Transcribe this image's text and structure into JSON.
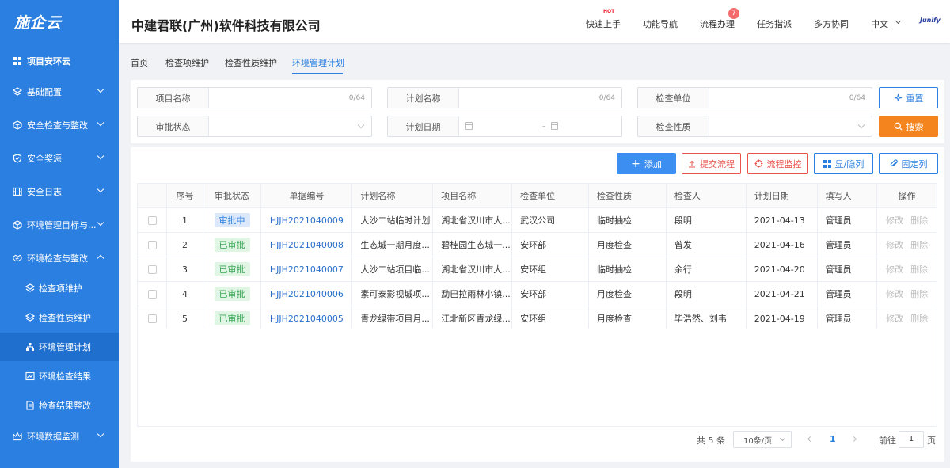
{
  "sidebar": {
    "logo": "施企云",
    "items": [
      {
        "label": "项目安环云",
        "icon": "grid-icon"
      },
      {
        "label": "基础配置",
        "icon": "layers-icon"
      },
      {
        "label": "安全检查与整改",
        "icon": "cube-icon"
      },
      {
        "label": "安全奖惩",
        "icon": "shield-icon"
      },
      {
        "label": "安全日志",
        "icon": "film-icon"
      },
      {
        "label": "环境管理目标与...",
        "icon": "cube-icon"
      },
      {
        "label": "环境检查与整改",
        "icon": "handshake-icon"
      },
      {
        "label": "环境数据监测",
        "icon": "monitor-icon"
      }
    ],
    "sub_items": [
      {
        "label": "检查项维护",
        "icon": "layers-icon"
      },
      {
        "label": "检查性质维护",
        "icon": "layers-icon"
      },
      {
        "label": "环境管理计划",
        "icon": "sitemap-icon"
      },
      {
        "label": "环境检查结果",
        "icon": "chart-icon"
      },
      {
        "label": "检查结果整改",
        "icon": "doc-icon"
      }
    ]
  },
  "header": {
    "company": "中建君联(广州)软件科技有限公司",
    "nav": [
      "快速上手",
      "功能导航",
      "流程办理",
      "任务指派",
      "多方协同",
      "中文"
    ],
    "hot_badge": "HOT",
    "process_badge": "7",
    "brand": "Junify"
  },
  "tabs": [
    "首页",
    "检查项维护",
    "检查性质维护",
    "环境管理计划"
  ],
  "search": {
    "project_name_label": "项目名称",
    "plan_name_label": "计划名称",
    "inspect_unit_label": "检查单位",
    "approval_status_label": "审批状态",
    "plan_date_label": "计划日期",
    "inspect_nature_label": "检查性质",
    "counter": "0/64",
    "date_sep": "-",
    "reset": "重置",
    "search": "搜索"
  },
  "toolbar": {
    "add": "添加",
    "submit": "提交流程",
    "monitor": "流程监控",
    "columns": "显/隐列",
    "pin": "固定列"
  },
  "table": {
    "headers": [
      "序号",
      "审批状态",
      "单据编号",
      "计划名称",
      "项目名称",
      "检查单位",
      "检查性质",
      "检查人",
      "计划日期",
      "填写人",
      "操作"
    ],
    "rows": [
      {
        "no": "1",
        "status": "审批中",
        "code": "HJJH2021040009",
        "plan": "大沙二站临时计划",
        "project": "湖北省汉川市大...",
        "unit": "武汉公司",
        "nature": "临时抽检",
        "inspector": "段明",
        "date": "2021-04-13",
        "filler": "管理员"
      },
      {
        "no": "2",
        "status": "已审批",
        "code": "HJJH2021040008",
        "plan": "生态城一期月度...",
        "project": "碧桂园生态城一...",
        "unit": "安环部",
        "nature": "月度检查",
        "inspector": "曾发",
        "date": "2021-04-16",
        "filler": "管理员"
      },
      {
        "no": "3",
        "status": "已审批",
        "code": "HJJH2021040007",
        "plan": "大沙二站项目临...",
        "project": "湖北省汉川市大...",
        "unit": "安环组",
        "nature": "临时抽检",
        "inspector": "余行",
        "date": "2021-04-20",
        "filler": "管理员"
      },
      {
        "no": "4",
        "status": "已审批",
        "code": "HJJH2021040006",
        "plan": "素可泰影视城项...",
        "project": "勐巴拉雨林小镇...",
        "unit": "安环部",
        "nature": "月度检查",
        "inspector": "段明",
        "date": "2021-04-21",
        "filler": "管理员"
      },
      {
        "no": "5",
        "status": "已审批",
        "code": "HJJH2021040005",
        "plan": "青龙绿带项目月...",
        "project": "江北新区青龙绿...",
        "unit": "安环组",
        "nature": "月度检查",
        "inspector": "毕浩然、刘韦",
        "date": "2021-04-19",
        "filler": "管理员"
      }
    ],
    "op_edit": "修改",
    "op_delete": "删除"
  },
  "pagination": {
    "total": "共 5 条",
    "page_size": "10条/页",
    "current": "1",
    "goto_label": "前往",
    "goto_value": "1",
    "page_unit": "页"
  },
  "colors": {
    "primary": "#2a7fe0",
    "orange": "#f4851e",
    "red": "#e8534b",
    "approved": "#3aa856"
  }
}
